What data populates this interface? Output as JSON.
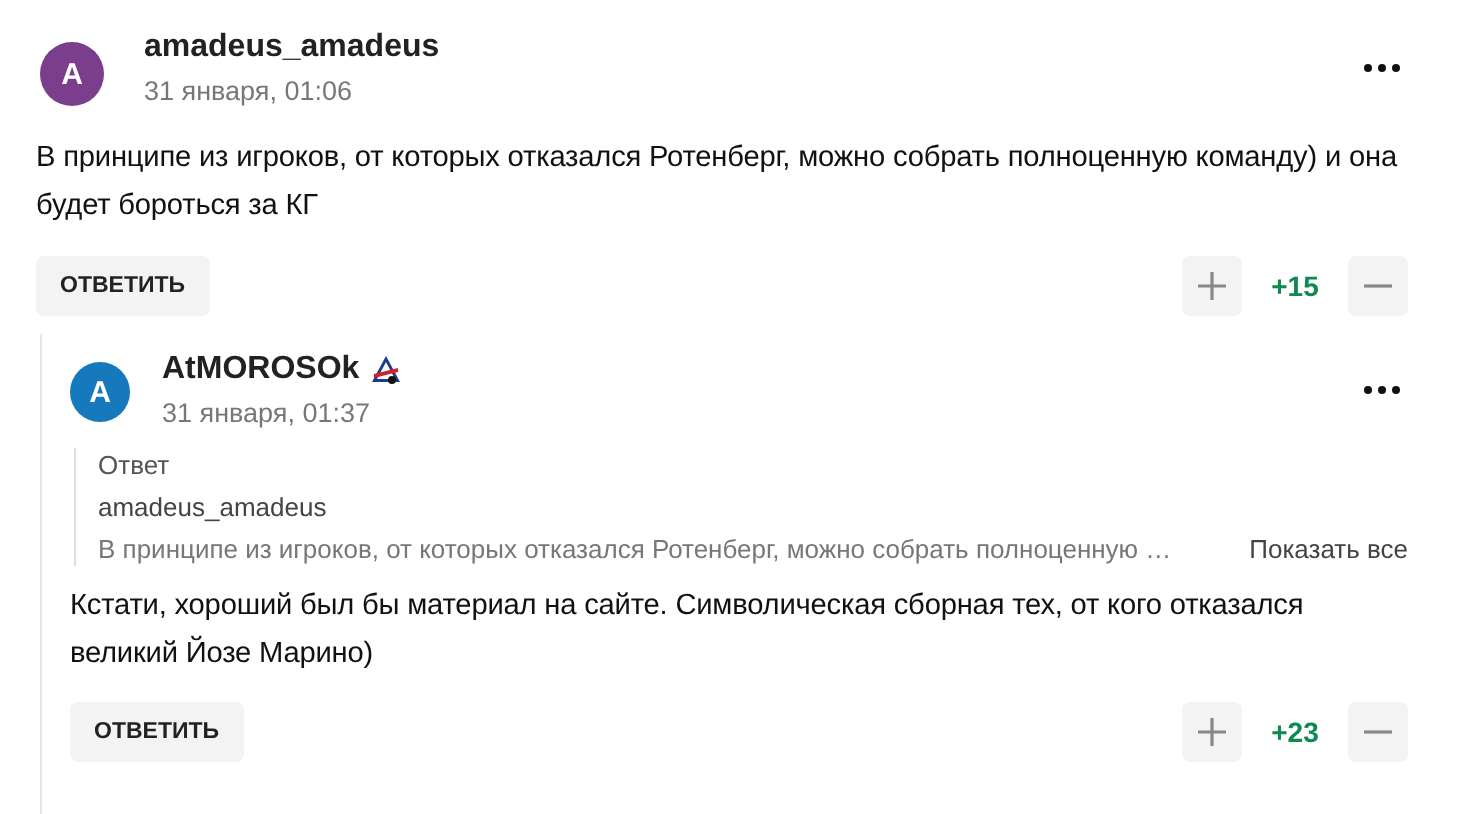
{
  "comments": [
    {
      "avatar_letter": "A",
      "color": "#7a3e8c",
      "author": "amadeus_amadeus",
      "badge": false,
      "date": "31 января, 01:06",
      "text": "В принципе из игроков, от которых отказался Ротенберг, можно собрать полноценную команду) и она будет бороться за КГ",
      "reply_button": "ОТВЕТИТЬ",
      "score": "+15",
      "replies": [
        {
          "avatar_letter": "A",
          "color": "#1679bd",
          "author": "AtMOROSOk",
          "badge": true,
          "date": "31 января, 01:37",
          "quote": {
            "label": "Ответ",
            "author": "amadeus_amadeus",
            "text": "В принципе из игроков, от которых отказался Ротенберг, можно собрать полноценную …",
            "show_all": "Показать все"
          },
          "text": "Кстати, хороший был бы материал на сайте. Символическая сборная тех, от кого отказался великий Йозе Марино)",
          "reply_button": "ОТВЕТИТЬ",
          "score": "+23"
        }
      ]
    }
  ]
}
